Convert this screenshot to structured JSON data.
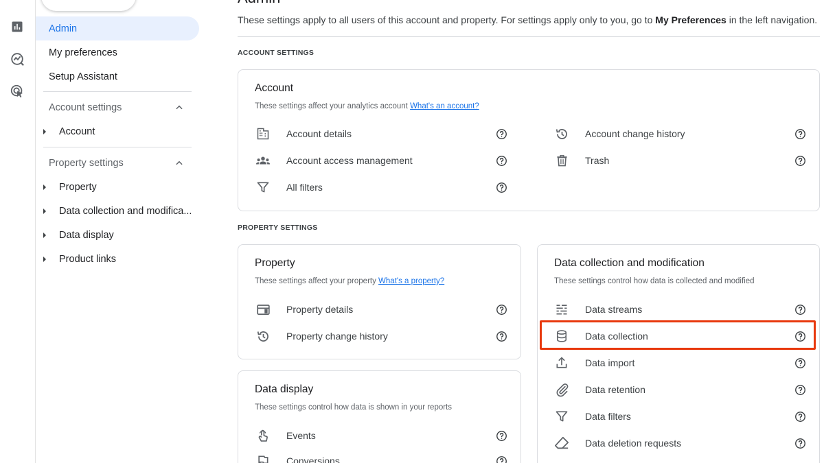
{
  "rail": {
    "icons": [
      "home-icon",
      "reports-icon",
      "explore-icon",
      "advertising-icon"
    ]
  },
  "nav": {
    "admin": "Admin",
    "my_preferences": "My preferences",
    "setup_assistant": "Setup Assistant",
    "account_settings": "Account settings",
    "account": "Account",
    "property_settings": "Property settings",
    "property": "Property",
    "data_collection": "Data collection and modifica...",
    "data_display": "Data display",
    "product_links": "Product links"
  },
  "main": {
    "title": "Admin",
    "intro_prefix": "These settings apply to all users of this account and property. For settings apply only to you, go to ",
    "intro_bold": "My Preferences",
    "intro_suffix": " in the left navigation.",
    "account_settings_heading": "ACCOUNT SETTINGS",
    "property_settings_heading": "PROPERTY SETTINGS"
  },
  "account_card": {
    "title": "Account",
    "desc": "These settings affect your analytics account ",
    "link": "What's an account?",
    "left_items": [
      "Account details",
      "Account access management",
      "All filters"
    ],
    "right_items": [
      "Account change history",
      "Trash"
    ]
  },
  "property_card": {
    "title": "Property",
    "desc": "These settings affect your property ",
    "link": "What's a property?",
    "items": [
      "Property details",
      "Property change history"
    ]
  },
  "display_card": {
    "title": "Data display",
    "desc": "These settings control how data is shown in your reports",
    "items": [
      "Events",
      "Conversions"
    ]
  },
  "collection_card": {
    "title": "Data collection and modification",
    "desc": "These settings control how data is collected and modified",
    "items": [
      "Data streams",
      "Data collection",
      "Data import",
      "Data retention",
      "Data filters",
      "Data deletion requests"
    ]
  },
  "colors": {
    "accent": "#1a73e8",
    "highlight": "#e8380d",
    "active_bg": "#e8f0fe"
  }
}
